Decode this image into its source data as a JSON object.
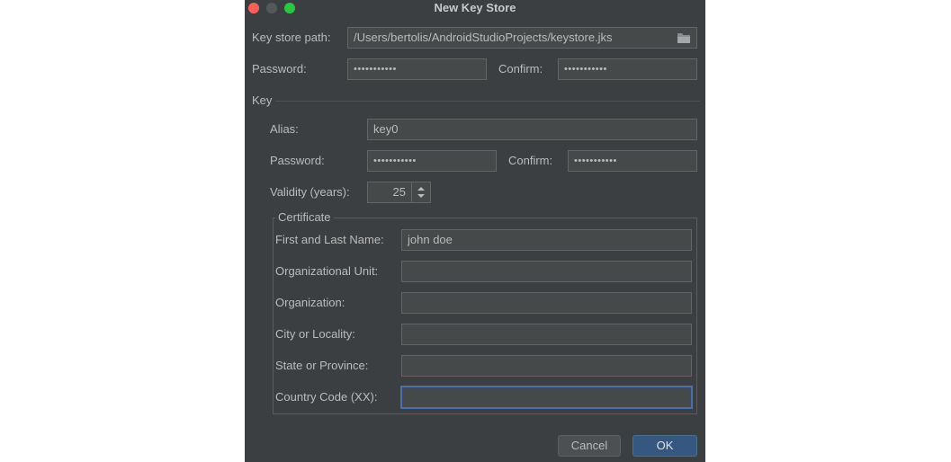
{
  "window": {
    "title": "New Key Store"
  },
  "keystore": {
    "path_label": "Key store path:",
    "path_value": "/Users/bertolis/AndroidStudioProjects/keystore.jks",
    "password_label": "Password:",
    "password_value": "•••••••••••",
    "confirm_label": "Confirm:",
    "confirm_value": "•••••••••••"
  },
  "key": {
    "section_label": "Key",
    "alias_label": "Alias:",
    "alias_value": "key0",
    "password_label": "Password:",
    "password_value": "•••••••••••",
    "confirm_label": "Confirm:",
    "confirm_value": "•••••••••••",
    "validity_label": "Validity (years):",
    "validity_value": "25"
  },
  "certificate": {
    "title": "Certificate",
    "fields": [
      {
        "label": "First and Last Name:",
        "value": "john doe"
      },
      {
        "label": "Organizational Unit:",
        "value": ""
      },
      {
        "label": "Organization:",
        "value": ""
      },
      {
        "label": "City or Locality:",
        "value": ""
      },
      {
        "label": "State or Province:",
        "value": ""
      },
      {
        "label": "Country Code (XX):",
        "value": ""
      }
    ]
  },
  "buttons": {
    "cancel": "Cancel",
    "ok": "OK"
  },
  "colors": {
    "background": "#3c3f41",
    "field": "#45494a",
    "accent": "#365880",
    "focus": "#4a6eaf"
  }
}
